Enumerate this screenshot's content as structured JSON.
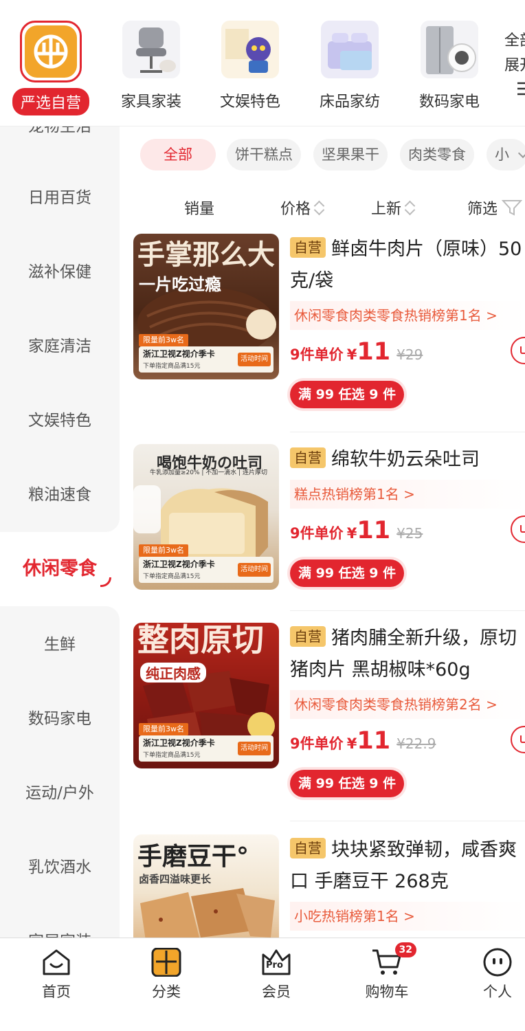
{
  "top_categories": [
    {
      "label": "严选自营",
      "icon": "yanxuan-logo-icon",
      "active": true
    },
    {
      "label": "家具家装",
      "icon": "chair-icon"
    },
    {
      "label": "文娱特色",
      "icon": "figure-icon"
    },
    {
      "label": "床品家纺",
      "icon": "bedding-icon"
    },
    {
      "label": "数码家电",
      "icon": "fridge-icon"
    }
  ],
  "more_categories": {
    "line1": "全部",
    "line2": "展开"
  },
  "sidebar": {
    "items": [
      {
        "label": "宠物生活"
      },
      {
        "label": "日用百货"
      },
      {
        "label": "滋补保健"
      },
      {
        "label": "家庭清洁"
      },
      {
        "label": "文娱特色"
      },
      {
        "label": "粮油速食"
      },
      {
        "label": "休闲零食",
        "active": true
      },
      {
        "label": "生鲜"
      },
      {
        "label": "数码家电"
      },
      {
        "label": "运动/户外"
      },
      {
        "label": "乳饮酒水"
      },
      {
        "label": "家居家装"
      }
    ]
  },
  "sub_categories": [
    "全部",
    "饼干糕点",
    "坚果果干",
    "肉类零食",
    "小"
  ],
  "sort": {
    "sales": "销量",
    "price": "价格",
    "new": "上新",
    "filter": "筛选"
  },
  "products": [
    {
      "badge": "自营",
      "title": "鲜卤牛肉片（原味）50克/袋",
      "rank": "休闲零食肉类零食热销榜第1名 >",
      "multi": "9件单价",
      "currency": "¥",
      "price": "11",
      "old_price": "¥29",
      "promo": "满 99 任选 9 件",
      "img": {
        "head": "手掌那么大",
        "sub": "一片吃过瘾",
        "limit": "限量前3w名",
        "b1": "浙江卫视Z视介季卡",
        "b2": "下单指定商品满15元",
        "b3": "活动时间"
      }
    },
    {
      "badge": "自营",
      "title": "绵软牛奶云朵吐司",
      "rank": "糕点热销榜第1名 >",
      "multi": "9件单价",
      "currency": "¥",
      "price": "11",
      "old_price": "¥25",
      "promo": "满 99 任选 9 件",
      "img": {
        "head": "喝饱牛奶の吐司",
        "sub": "牛乳添加量≥20% | 不加一滴水 | 连片厚切",
        "limit": "限量前3w名",
        "b1": "浙江卫视Z视介季卡",
        "b2": "下单指定商品满15元",
        "b3": "活动时间"
      }
    },
    {
      "badge": "自营",
      "title": "猪肉脯全新升级，原切猪肉片 黑胡椒味*60g",
      "rank": "休闲零食肉类零食热销榜第2名 >",
      "multi": "9件单价",
      "currency": "¥",
      "price": "11",
      "old_price": "¥22.9",
      "promo": "满 99 任选 9 件",
      "img": {
        "head": "整肉原切",
        "sub": "纯正肉感",
        "limit": "限量前3w名",
        "b1": "浙江卫视Z视介季卡",
        "b2": "下单指定商品满15元",
        "b3": "活动时间"
      }
    },
    {
      "badge": "自营",
      "title": "块块紧致弹韧，咸香爽口 手磨豆干 268克",
      "rank": "小吃热销榜第1名 >",
      "img": {
        "head": "手磨豆干°",
        "sub": "卤香四溢味更长"
      }
    }
  ],
  "tabbar": [
    {
      "label": "首页",
      "icon": "home-icon"
    },
    {
      "label": "分类",
      "icon": "category-icon"
    },
    {
      "label": "会员",
      "icon": "pro-member-icon",
      "pro": "Pro"
    },
    {
      "label": "购物车",
      "icon": "cart-icon",
      "badge": "32"
    },
    {
      "label": "个人",
      "icon": "profile-icon"
    }
  ],
  "colors": {
    "accent": "#e2262f",
    "rank_text": "#e85a3b",
    "self_badge": "#f5c66a"
  }
}
